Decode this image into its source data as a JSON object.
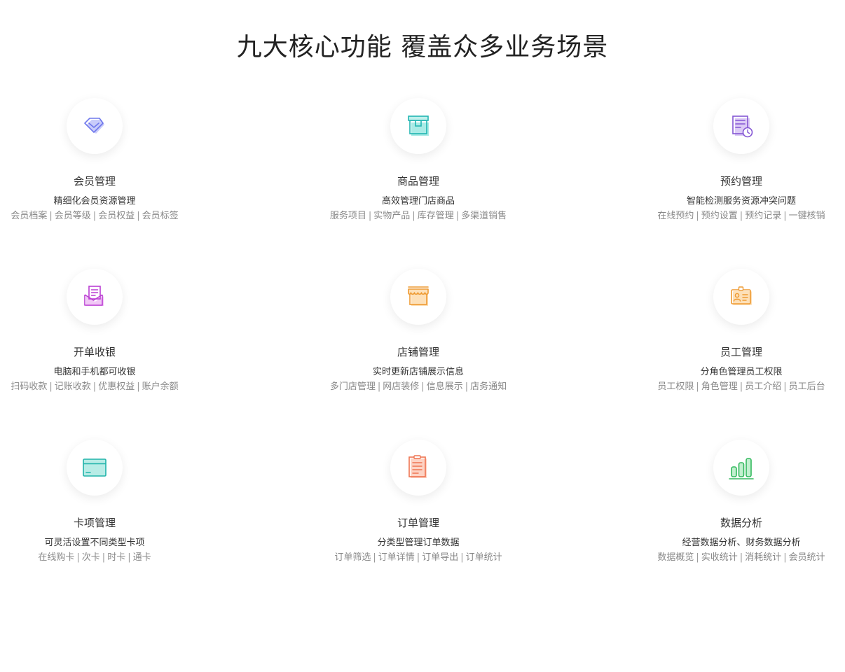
{
  "page_title": "九大核心功能 覆盖众多业务场景",
  "features": [
    {
      "title": "会员管理",
      "desc": "精细化会员资源管理",
      "tags": [
        "会员档案",
        "会员等级",
        "会员权益",
        "会员标签"
      ],
      "icon": "diamond-icon",
      "color": "#7b83f0"
    },
    {
      "title": "商品管理",
      "desc": "高效管理门店商品",
      "tags": [
        "服务项目",
        "实物产品",
        "库存管理",
        "多渠道销售"
      ],
      "icon": "box-icon",
      "color": "#2fc2c0"
    },
    {
      "title": "预约管理",
      "desc": "智能检测服务资源冲突问题",
      "tags": [
        "在线预约",
        "预约设置",
        "预约记录",
        "一键核销"
      ],
      "icon": "schedule-icon",
      "color": "#8b62d9"
    },
    {
      "title": "开单收银",
      "desc": "电脑和手机都可收银",
      "tags": [
        "扫码收款",
        "记账收款",
        "优惠权益",
        "账户余额"
      ],
      "icon": "envelope-receipt-icon",
      "color": "#c049d8"
    },
    {
      "title": "店铺管理",
      "desc": "实时更新店铺展示信息",
      "tags": [
        "多门店管理",
        "网店装修",
        "信息展示",
        "店务通知"
      ],
      "icon": "storefront-icon",
      "color": "#f0a040"
    },
    {
      "title": "员工管理",
      "desc": "分角色管理员工权限",
      "tags": [
        "员工权限",
        "角色管理",
        "员工介绍",
        "员工后台"
      ],
      "icon": "id-badge-icon",
      "color": "#f0a040"
    },
    {
      "title": "卡项管理",
      "desc": "可灵活设置不同类型卡项",
      "tags": [
        "在线购卡",
        "次卡",
        "时卡",
        "通卡"
      ],
      "icon": "card-icon",
      "color": "#2fb8b0"
    },
    {
      "title": "订单管理",
      "desc": "分类型管理订单数据",
      "tags": [
        "订单筛选",
        "订单详情",
        "订单导出",
        "订单统计"
      ],
      "icon": "clipboard-icon",
      "color": "#f07a5a"
    },
    {
      "title": "数据分析",
      "desc": "经营数据分析、财务数据分析",
      "tags": [
        "数据概览",
        "实收统计",
        "消耗统计",
        "会员统计"
      ],
      "icon": "bar-chart-icon",
      "color": "#3fc26a"
    }
  ]
}
